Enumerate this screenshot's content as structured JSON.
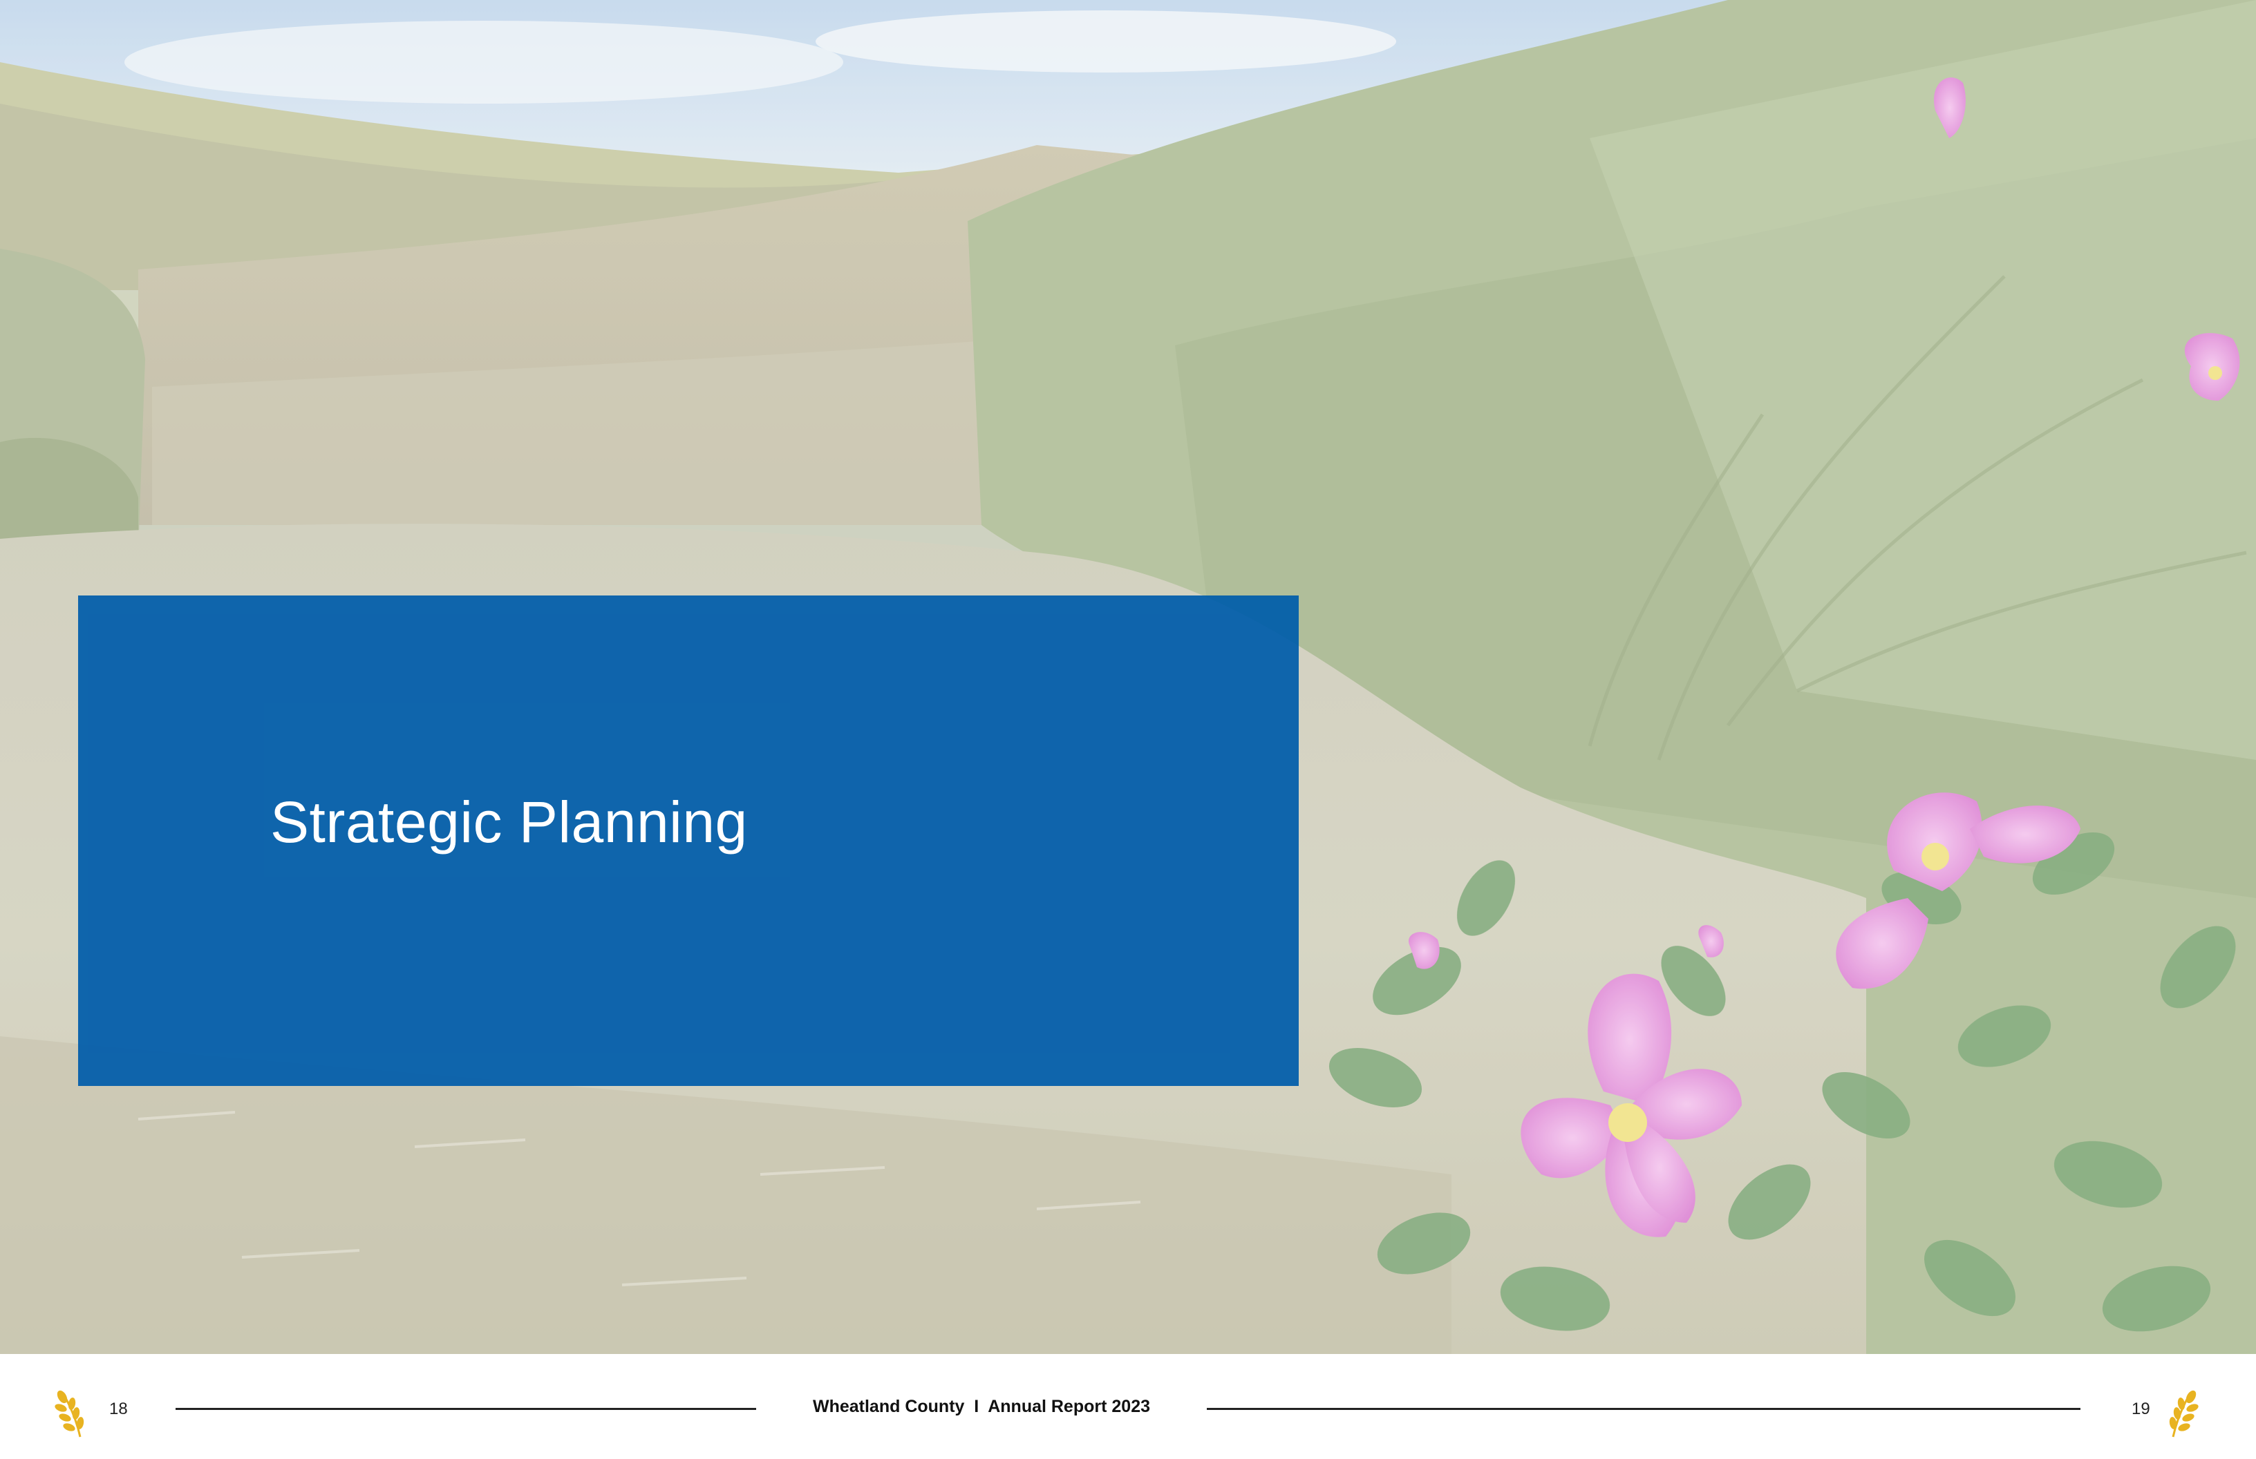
{
  "section": {
    "title": "Strategic Planning"
  },
  "footer": {
    "left_page_number": "18",
    "right_page_number": "19",
    "publication": "Wheatland County  I  Annual Report 2023"
  },
  "icons": {
    "page_marker": "wheat-icon"
  },
  "colors": {
    "panel_blue": "#005CAA",
    "wheat_gold": "#E8B321",
    "footer_text": "#111111"
  }
}
